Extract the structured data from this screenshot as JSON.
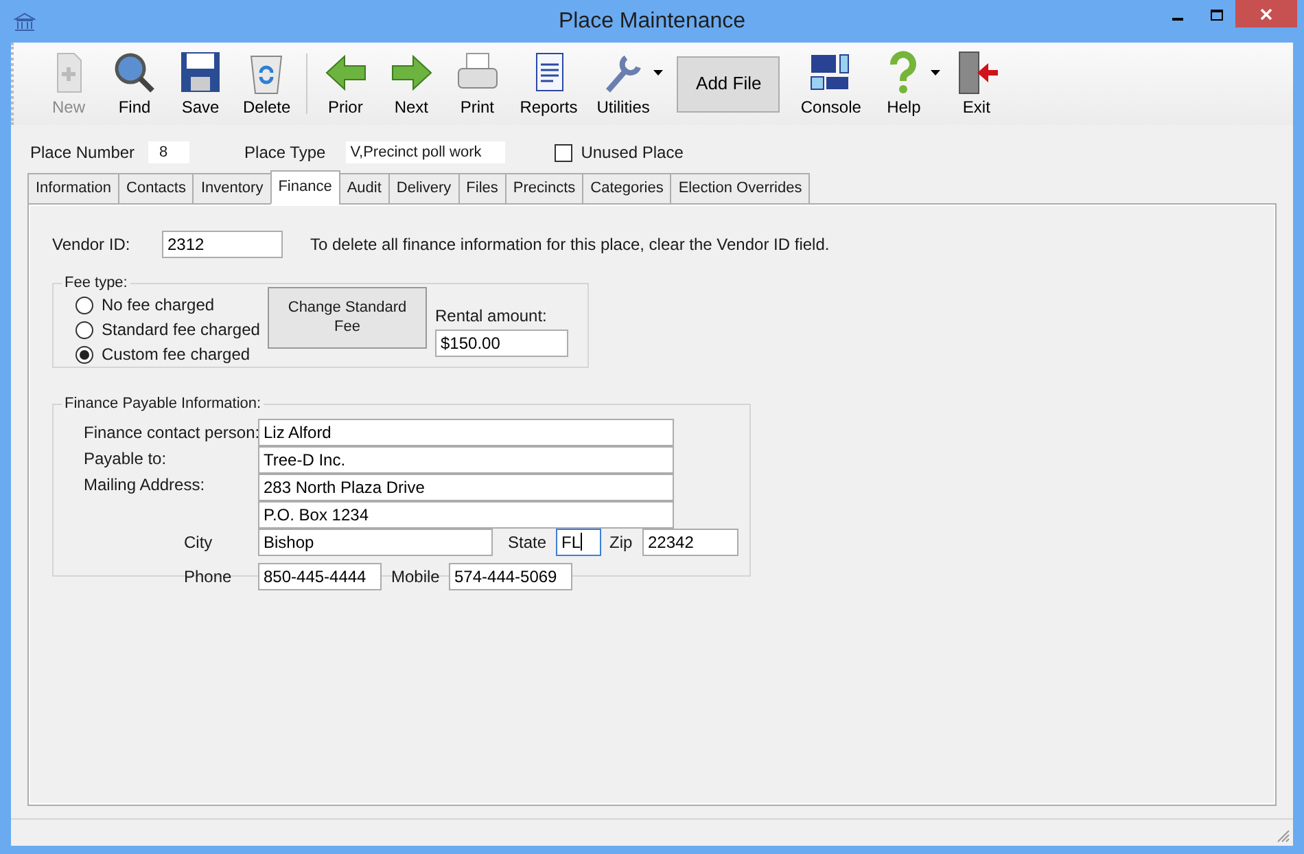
{
  "window": {
    "title": "Place Maintenance"
  },
  "toolbar": [
    {
      "label": "New",
      "kind": "tool",
      "disabled": true
    },
    {
      "label": "Find",
      "kind": "tool",
      "disabled": false
    },
    {
      "label": "Save",
      "kind": "tool",
      "disabled": false
    },
    {
      "label": "Delete",
      "kind": "tool",
      "disabled": false
    },
    {
      "label": "Prior",
      "kind": "tool",
      "disabled": false
    },
    {
      "label": "Next",
      "kind": "tool",
      "disabled": false
    },
    {
      "label": "Print",
      "kind": "tool",
      "disabled": false
    },
    {
      "label": "Reports",
      "kind": "tool",
      "disabled": false
    },
    {
      "label": "Utilities",
      "kind": "tool-menu",
      "disabled": false
    },
    {
      "label": "Add File",
      "kind": "text-button",
      "disabled": false
    },
    {
      "label": "Console",
      "kind": "tool",
      "disabled": false
    },
    {
      "label": "Help",
      "kind": "tool-menu",
      "disabled": false
    },
    {
      "label": "Exit",
      "kind": "tool",
      "disabled": false
    }
  ],
  "header": {
    "place_number": {
      "label": "Place Number",
      "value": "8"
    },
    "place_type": {
      "label": "Place Type",
      "value": "V,Precinct poll work"
    },
    "unused_place": {
      "label": "Unused Place",
      "checked": false
    }
  },
  "tabs": [
    {
      "label": "Information",
      "selected": false
    },
    {
      "label": "Contacts",
      "selected": false
    },
    {
      "label": "Inventory",
      "selected": false
    },
    {
      "label": "Finance",
      "selected": true
    },
    {
      "label": "Audit",
      "selected": false
    },
    {
      "label": "Delivery",
      "selected": false
    },
    {
      "label": "Files",
      "selected": false
    },
    {
      "label": "Precincts",
      "selected": false
    },
    {
      "label": "Categories",
      "selected": false
    },
    {
      "label": "Election Overrides",
      "selected": false
    }
  ],
  "vendor": {
    "label": "Vendor ID:",
    "value": "2312",
    "note": "To delete all finance information for this place, clear the Vendor ID field."
  },
  "fee_type": {
    "legend": "Fee type:",
    "options": [
      {
        "label": "No fee charged",
        "selected": false
      },
      {
        "label": "Standard fee charged",
        "selected": false
      },
      {
        "label": "Custom fee charged",
        "selected": true
      }
    ],
    "button": "Change Standard Fee",
    "rental": {
      "label": "Rental amount:",
      "value": "$150.00"
    }
  },
  "payable": {
    "legend": "Finance Payable Information:",
    "contact": {
      "label": "Finance contact person:",
      "value": "Liz Alford"
    },
    "payable_to": {
      "label": "Payable to:",
      "value": "Tree-D Inc."
    },
    "address": {
      "label": "Mailing Address:",
      "lines": [
        "283 North Plaza Drive",
        "P.O. Box 1234"
      ]
    },
    "city": {
      "label": "City",
      "value": "Bishop"
    },
    "state": {
      "label": "State",
      "value": "FL",
      "focused": true
    },
    "zip": {
      "label": "Zip",
      "value": "22342"
    },
    "phone": {
      "label": "Phone",
      "value": "850-445-4444"
    },
    "mobile": {
      "label": "Mobile",
      "value": "574-444-5069"
    }
  }
}
